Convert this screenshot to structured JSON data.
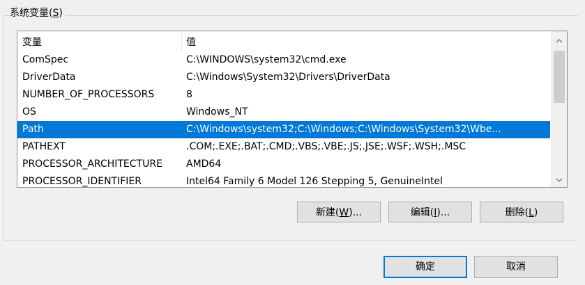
{
  "group": {
    "title_main": "系统变量(",
    "title_key": "S",
    "title_end": ")"
  },
  "list": {
    "headers": [
      "变量",
      "值"
    ],
    "rows": [
      {
        "name": "ComSpec",
        "value": "C:\\WINDOWS\\system32\\cmd.exe"
      },
      {
        "name": "DriverData",
        "value": "C:\\Windows\\System32\\Drivers\\DriverData"
      },
      {
        "name": "NUMBER_OF_PROCESSORS",
        "value": "8"
      },
      {
        "name": "OS",
        "value": "Windows_NT"
      },
      {
        "name": "Path",
        "value": "C:\\Windows\\system32;C:\\Windows;C:\\Windows\\System32\\Wbe..."
      },
      {
        "name": "PATHEXT",
        "value": ".COM;.EXE;.BAT;.CMD;.VBS;.VBE;.JS;.JSE;.WSF;.WSH;.MSC"
      },
      {
        "name": "PROCESSOR_ARCHITECTURE",
        "value": "AMD64"
      },
      {
        "name": "PROCESSOR_IDENTIFIER",
        "value": "Intel64 Family 6 Model 126 Stepping 5, GenuineIntel"
      }
    ],
    "selected_index": 4
  },
  "scrollbar": {
    "up_icon": "chevron-up-icon",
    "down_icon": "chevron-down-icon"
  },
  "buttons": {
    "new_main": "新建(",
    "new_key": "W",
    "new_end": ")...",
    "edit_main": "编辑(",
    "edit_key": "I",
    "edit_end": ")...",
    "delete_main": "删除(",
    "delete_key": "L",
    "delete_end": ")",
    "ok": "确定",
    "cancel": "取消"
  },
  "colors": {
    "selection": "#0078d7",
    "list_border": "#828790",
    "button_face": "#e1e1e1"
  }
}
